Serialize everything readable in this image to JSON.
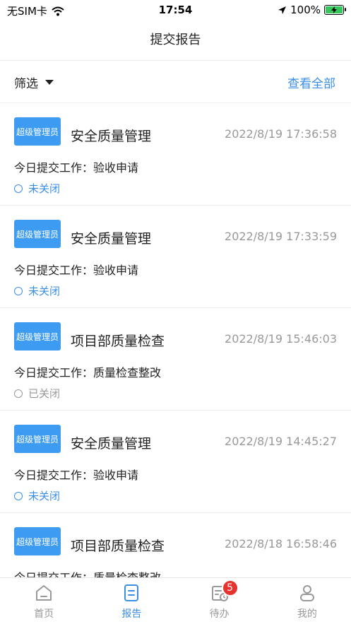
{
  "status_bar": {
    "carrier": "无SIM卡",
    "time": "17:54",
    "battery": "100%"
  },
  "nav": {
    "title": "提交报告"
  },
  "filter": {
    "label": "筛选",
    "view_all": "查看全部"
  },
  "reports": [
    {
      "role": "超级管理员",
      "title": "安全质量管理",
      "time": "2022/8/19 17:36:58",
      "work": "今日提交工作：验收申请",
      "status": "未关闭",
      "closed": false
    },
    {
      "role": "超级管理员",
      "title": "安全质量管理",
      "time": "2022/8/19 17:33:59",
      "work": "今日提交工作：验收申请",
      "status": "未关闭",
      "closed": false
    },
    {
      "role": "超级管理员",
      "title": "项目部质量检查",
      "time": "2022/8/19 15:46:03",
      "work": "今日提交工作：质量检查整改",
      "status": "已关闭",
      "closed": true
    },
    {
      "role": "超级管理员",
      "title": "安全质量管理",
      "time": "2022/8/19 14:45:27",
      "work": "今日提交工作：验收申请",
      "status": "未关闭",
      "closed": false
    },
    {
      "role": "超级管理员",
      "title": "项目部质量检查",
      "time": "2022/8/18 16:58:46",
      "work": "今日提交工作：质量检查整改",
      "status": "",
      "closed": false
    }
  ],
  "tabs": [
    {
      "label": "首页",
      "icon": "home-icon"
    },
    {
      "label": "报告",
      "icon": "report-icon"
    },
    {
      "label": "待办",
      "icon": "todo-icon",
      "badge": "5"
    },
    {
      "label": "我的",
      "icon": "user-icon"
    }
  ],
  "colors": {
    "accent": "#3a8ee6",
    "badge_bg": "#3e9bf2",
    "alert": "#e5332f"
  }
}
